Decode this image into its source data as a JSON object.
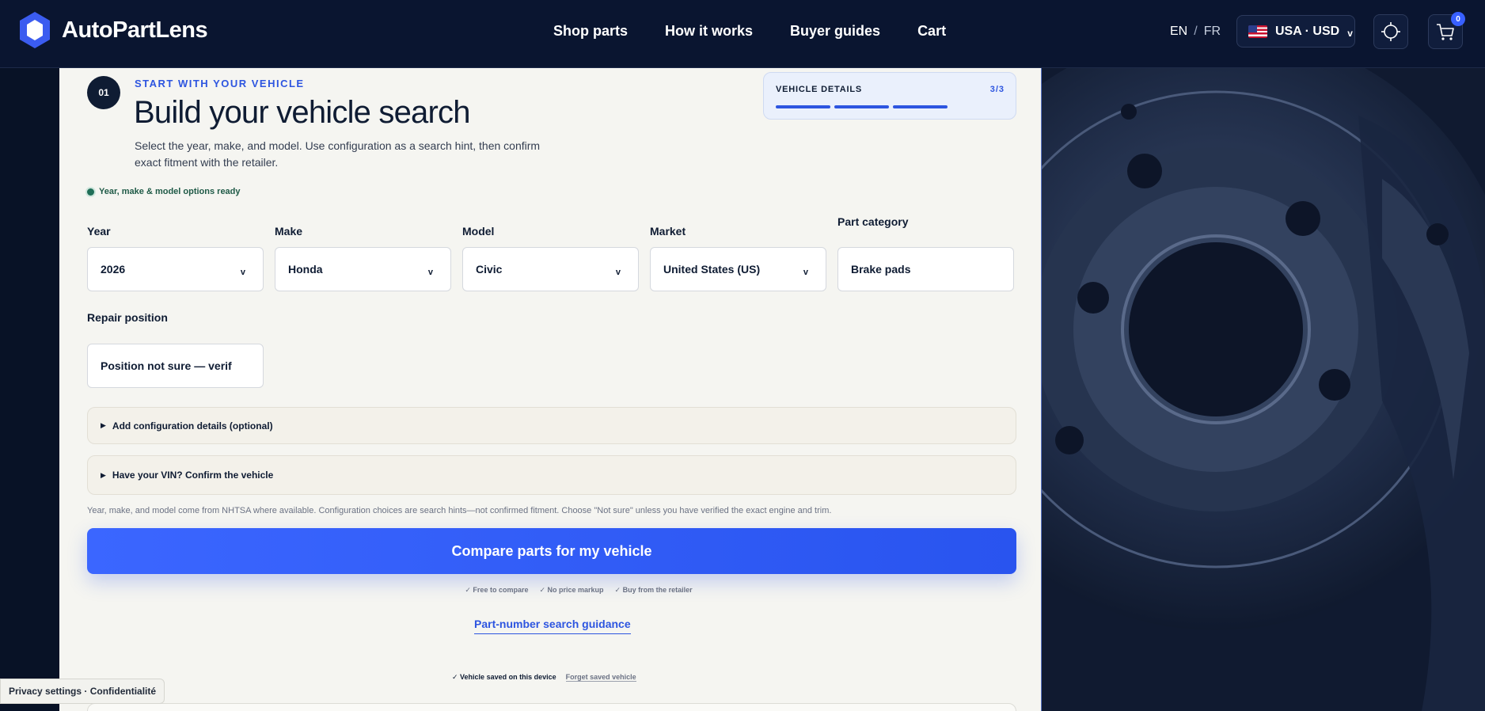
{
  "header": {
    "brand": "AutoPartLens",
    "nav": [
      "Shop parts",
      "How it works",
      "Buyer guides",
      "Cart"
    ],
    "lang_active": "EN",
    "lang_sep": "/",
    "lang_other": "FR",
    "region": "USA · USD",
    "cart_count": "0"
  },
  "step": {
    "number": "01",
    "eyebrow": "START WITH YOUR VEHICLE",
    "title": "Build your vehicle search",
    "subtitle": "Select the year, make, and model. Use configuration as a search hint, then confirm exact fitment with the retailer."
  },
  "progress": {
    "label": "VEHICLE DETAILS",
    "count": "3/3",
    "fraction": 1.0
  },
  "status": "Year, make & model options ready",
  "fields": {
    "year": {
      "label": "Year",
      "value": "2026"
    },
    "make": {
      "label": "Make",
      "value": "Honda"
    },
    "model": {
      "label": "Model",
      "value": "Civic"
    },
    "market": {
      "label": "Market",
      "value": "United States (US)"
    },
    "category": {
      "label": "Part category",
      "value": "Brake pads"
    },
    "position": {
      "label": "Repair position",
      "value": "Position not sure — verif"
    }
  },
  "expanders": {
    "config": "Add configuration details (optional)",
    "vin": "Have your VIN? Confirm the vehicle"
  },
  "note": "Year, make, and model come from NHTSA where available. Configuration choices are search hints—not confirmed fitment. Choose \"Not sure\" unless you have verified the exact engine and trim.",
  "cta": "Compare parts for my vehicle",
  "benefits": [
    "✓ Free to compare",
    "✓ No price markup",
    "✓ Buy from the retailer"
  ],
  "guidance_link": "Part-number search guidance",
  "saved": {
    "text": "✓ Vehicle saved on this device",
    "forget": "Forget saved vehicle"
  },
  "privacy": "Privacy settings · Confidentialité",
  "colors": {
    "accent": "#2d55e0",
    "navy": "#0a1530",
    "card_bg": "#f5f5f1"
  }
}
